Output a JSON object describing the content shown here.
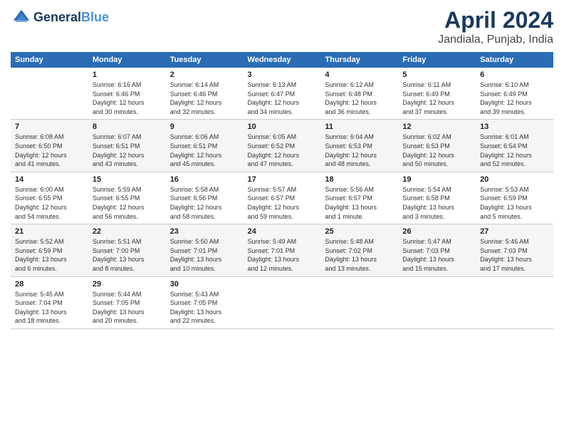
{
  "header": {
    "logo_line1": "General",
    "logo_line2": "Blue",
    "title": "April 2024",
    "subtitle": "Jandiala, Punjab, India"
  },
  "days_of_week": [
    "Sunday",
    "Monday",
    "Tuesday",
    "Wednesday",
    "Thursday",
    "Friday",
    "Saturday"
  ],
  "weeks": [
    [
      {
        "num": "",
        "info": ""
      },
      {
        "num": "1",
        "info": "Sunrise: 6:16 AM\nSunset: 6:46 PM\nDaylight: 12 hours\nand 30 minutes."
      },
      {
        "num": "2",
        "info": "Sunrise: 6:14 AM\nSunset: 6:46 PM\nDaylight: 12 hours\nand 32 minutes."
      },
      {
        "num": "3",
        "info": "Sunrise: 6:13 AM\nSunset: 6:47 PM\nDaylight: 12 hours\nand 34 minutes."
      },
      {
        "num": "4",
        "info": "Sunrise: 6:12 AM\nSunset: 6:48 PM\nDaylight: 12 hours\nand 36 minutes."
      },
      {
        "num": "5",
        "info": "Sunrise: 6:11 AM\nSunset: 6:49 PM\nDaylight: 12 hours\nand 37 minutes."
      },
      {
        "num": "6",
        "info": "Sunrise: 6:10 AM\nSunset: 6:49 PM\nDaylight: 12 hours\nand 39 minutes."
      }
    ],
    [
      {
        "num": "7",
        "info": "Sunrise: 6:08 AM\nSunset: 6:50 PM\nDaylight: 12 hours\nand 41 minutes."
      },
      {
        "num": "8",
        "info": "Sunrise: 6:07 AM\nSunset: 6:51 PM\nDaylight: 12 hours\nand 43 minutes."
      },
      {
        "num": "9",
        "info": "Sunrise: 6:06 AM\nSunset: 6:51 PM\nDaylight: 12 hours\nand 45 minutes."
      },
      {
        "num": "10",
        "info": "Sunrise: 6:05 AM\nSunset: 6:52 PM\nDaylight: 12 hours\nand 47 minutes."
      },
      {
        "num": "11",
        "info": "Sunrise: 6:04 AM\nSunset: 6:53 PM\nDaylight: 12 hours\nand 48 minutes."
      },
      {
        "num": "12",
        "info": "Sunrise: 6:02 AM\nSunset: 6:53 PM\nDaylight: 12 hours\nand 50 minutes."
      },
      {
        "num": "13",
        "info": "Sunrise: 6:01 AM\nSunset: 6:54 PM\nDaylight: 12 hours\nand 52 minutes."
      }
    ],
    [
      {
        "num": "14",
        "info": "Sunrise: 6:00 AM\nSunset: 6:55 PM\nDaylight: 12 hours\nand 54 minutes."
      },
      {
        "num": "15",
        "info": "Sunrise: 5:59 AM\nSunset: 6:55 PM\nDaylight: 12 hours\nand 56 minutes."
      },
      {
        "num": "16",
        "info": "Sunrise: 5:58 AM\nSunset: 6:56 PM\nDaylight: 12 hours\nand 58 minutes."
      },
      {
        "num": "17",
        "info": "Sunrise: 5:57 AM\nSunset: 6:57 PM\nDaylight: 12 hours\nand 59 minutes."
      },
      {
        "num": "18",
        "info": "Sunrise: 5:56 AM\nSunset: 6:57 PM\nDaylight: 13 hours\nand 1 minute."
      },
      {
        "num": "19",
        "info": "Sunrise: 5:54 AM\nSunset: 6:58 PM\nDaylight: 13 hours\nand 3 minutes."
      },
      {
        "num": "20",
        "info": "Sunrise: 5:53 AM\nSunset: 6:59 PM\nDaylight: 13 hours\nand 5 minutes."
      }
    ],
    [
      {
        "num": "21",
        "info": "Sunrise: 5:52 AM\nSunset: 6:59 PM\nDaylight: 13 hours\nand 6 minutes."
      },
      {
        "num": "22",
        "info": "Sunrise: 5:51 AM\nSunset: 7:00 PM\nDaylight: 13 hours\nand 8 minutes."
      },
      {
        "num": "23",
        "info": "Sunrise: 5:50 AM\nSunset: 7:01 PM\nDaylight: 13 hours\nand 10 minutes."
      },
      {
        "num": "24",
        "info": "Sunrise: 5:49 AM\nSunset: 7:01 PM\nDaylight: 13 hours\nand 12 minutes."
      },
      {
        "num": "25",
        "info": "Sunrise: 5:48 AM\nSunset: 7:02 PM\nDaylight: 13 hours\nand 13 minutes."
      },
      {
        "num": "26",
        "info": "Sunrise: 5:47 AM\nSunset: 7:03 PM\nDaylight: 13 hours\nand 15 minutes."
      },
      {
        "num": "27",
        "info": "Sunrise: 5:46 AM\nSunset: 7:03 PM\nDaylight: 13 hours\nand 17 minutes."
      }
    ],
    [
      {
        "num": "28",
        "info": "Sunrise: 5:45 AM\nSunset: 7:04 PM\nDaylight: 13 hours\nand 18 minutes."
      },
      {
        "num": "29",
        "info": "Sunrise: 5:44 AM\nSunset: 7:05 PM\nDaylight: 13 hours\nand 20 minutes."
      },
      {
        "num": "30",
        "info": "Sunrise: 5:43 AM\nSunset: 7:05 PM\nDaylight: 13 hours\nand 22 minutes."
      },
      {
        "num": "",
        "info": ""
      },
      {
        "num": "",
        "info": ""
      },
      {
        "num": "",
        "info": ""
      },
      {
        "num": "",
        "info": ""
      }
    ]
  ]
}
